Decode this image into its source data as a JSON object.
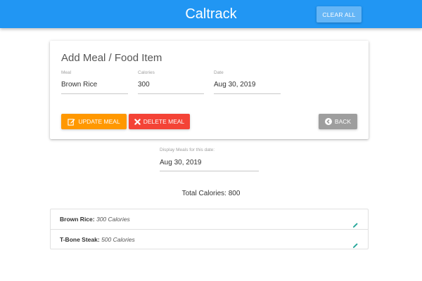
{
  "navbar": {
    "brand": "Caltrack",
    "clear_label": "CLEAR ALL",
    "color": "#2196f3"
  },
  "form": {
    "title": "Add Meal / Food Item",
    "meal": {
      "label": "Meal",
      "value": "Brown Rice"
    },
    "calories": {
      "label": "Calories",
      "value": "300"
    },
    "date": {
      "label": "Date",
      "value": "Aug 30, 2019"
    },
    "update_label": "UPDATE MEAL",
    "delete_label": "DELETE MEAL",
    "back_label": "BACK",
    "update_icon": "edit-icon",
    "delete_icon": "close-icon",
    "back_icon": "chevron-left-circle-icon"
  },
  "display": {
    "label": "Display Meals for this date:",
    "value": "Aug 30, 2019"
  },
  "total": "Total Calories: 800",
  "meals": [
    {
      "name": "Brown Rice:",
      "calories": "300 Calories"
    },
    {
      "name": "T-Bone Steak:",
      "calories": "500 Calories"
    }
  ],
  "colors": {
    "update": "#ff9800",
    "delete": "#f44336",
    "back": "#9e9e9e",
    "edit_icon": "#26a69a"
  }
}
